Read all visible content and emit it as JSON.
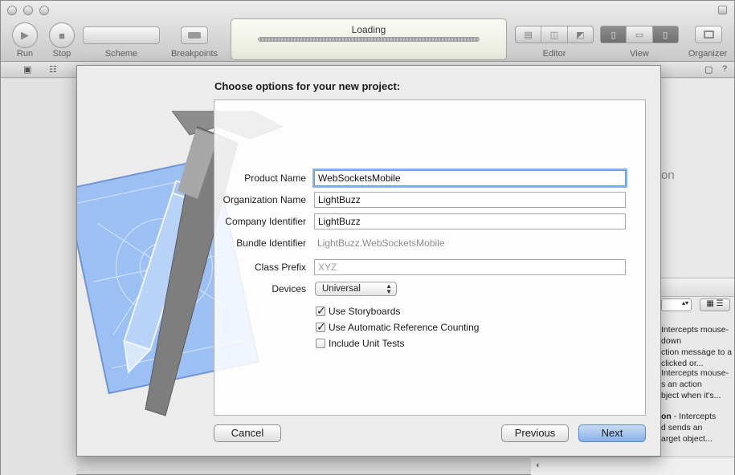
{
  "toolbar": {
    "run_label": "Run",
    "stop_label": "Stop",
    "scheme_label": "Scheme",
    "breakpoints_label": "Breakpoints",
    "activity_title": "Loading",
    "editor_label": "Editor",
    "view_label": "View",
    "organizer_label": "Organizer"
  },
  "sheet": {
    "title": "Choose options for your new project:",
    "fields": {
      "product_name_label": "Product Name",
      "product_name_value": "WebSocketsMobile",
      "organization_name_label": "Organization Name",
      "organization_name_value": "LightBuzz",
      "company_identifier_label": "Company Identifier",
      "company_identifier_value": "LightBuzz",
      "bundle_identifier_label": "Bundle Identifier",
      "bundle_identifier_value": "LightBuzz.WebSocketsMobile",
      "class_prefix_label": "Class Prefix",
      "class_prefix_placeholder": "XYZ",
      "devices_label": "Devices",
      "devices_value": "Universal"
    },
    "checkboxes": [
      {
        "label": "Use Storyboards",
        "checked": true
      },
      {
        "label": "Use Automatic Reference Counting",
        "checked": true
      },
      {
        "label": "Include Unit Tests",
        "checked": false
      }
    ],
    "buttons": {
      "cancel": "Cancel",
      "previous": "Previous",
      "next": "Next"
    }
  },
  "background_inspector": {
    "partial_heading": "on",
    "item1_line1": "Intercepts mouse-down",
    "item1_line2": "ction message to a",
    "item1_line3": "clicked or...",
    "item2_line1": "Intercepts mouse-",
    "item2_line2": "s an action",
    "item2_line3": "bject when it's...",
    "item3_bold": "on",
    "item3_line1": "- Intercepts",
    "item3_line2": "d sends an",
    "item3_line3": "arget object..."
  }
}
